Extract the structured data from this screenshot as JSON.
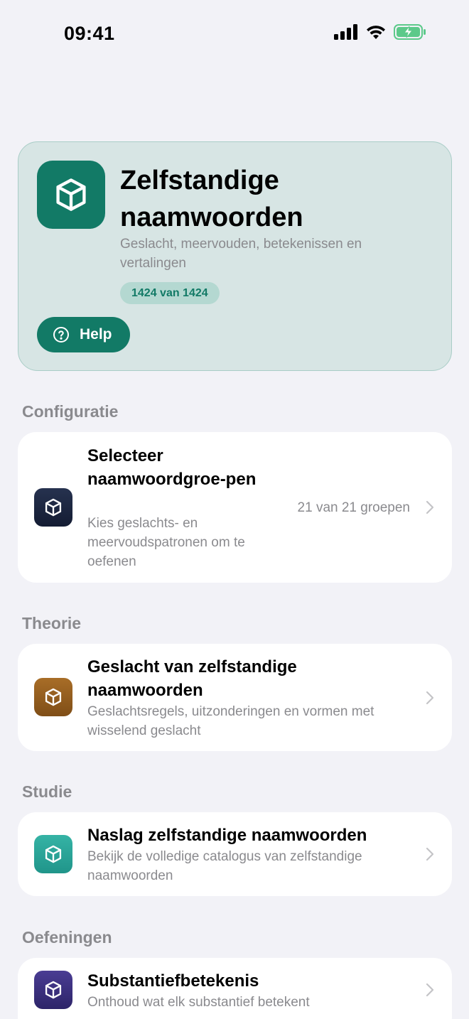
{
  "status_bar": {
    "time": "09:41"
  },
  "hero": {
    "title": "Zelfstandige naamwoorden",
    "subtitle": "Geslacht, meervouden, betekenissen en vertalingen",
    "badge": "1424 van 1424",
    "help_label": "Help",
    "icon": "cube-icon",
    "accent": "#127a66",
    "background": "#d7e5e4"
  },
  "sections": {
    "configuratie": {
      "header": "Configuratie",
      "item": {
        "title": "Selecteer naamwoordgroe-pen",
        "subtitle": "Kies geslachts- en meervoudspatronen om te oefenen",
        "value": "21 van 21 groepen",
        "icon": "cube-icon",
        "icon_color": "#1a2540"
      }
    },
    "theorie": {
      "header": "Theorie",
      "item": {
        "title": "Geslacht van zelfstandige naamwoorden",
        "subtitle": "Geslachtsregels, uitzonderingen en vormen met wisselend geslacht",
        "icon": "cube-icon",
        "icon_color": "#8e5a1e"
      }
    },
    "studie": {
      "header": "Studie",
      "item": {
        "title": "Naslag zelfstandige naamwoorden",
        "subtitle": "Bekijk de volledige catalogus van zelfstandige naamwoorden",
        "icon": "cube-icon",
        "icon_color": "#2aa597"
      }
    },
    "oefeningen": {
      "header": "Oefeningen",
      "item": {
        "title": "Substantiefbetekenis",
        "subtitle": "Onthoud wat elk substantief betekent",
        "icon": "cube-icon",
        "icon_color": "#3a2f7e"
      }
    }
  }
}
